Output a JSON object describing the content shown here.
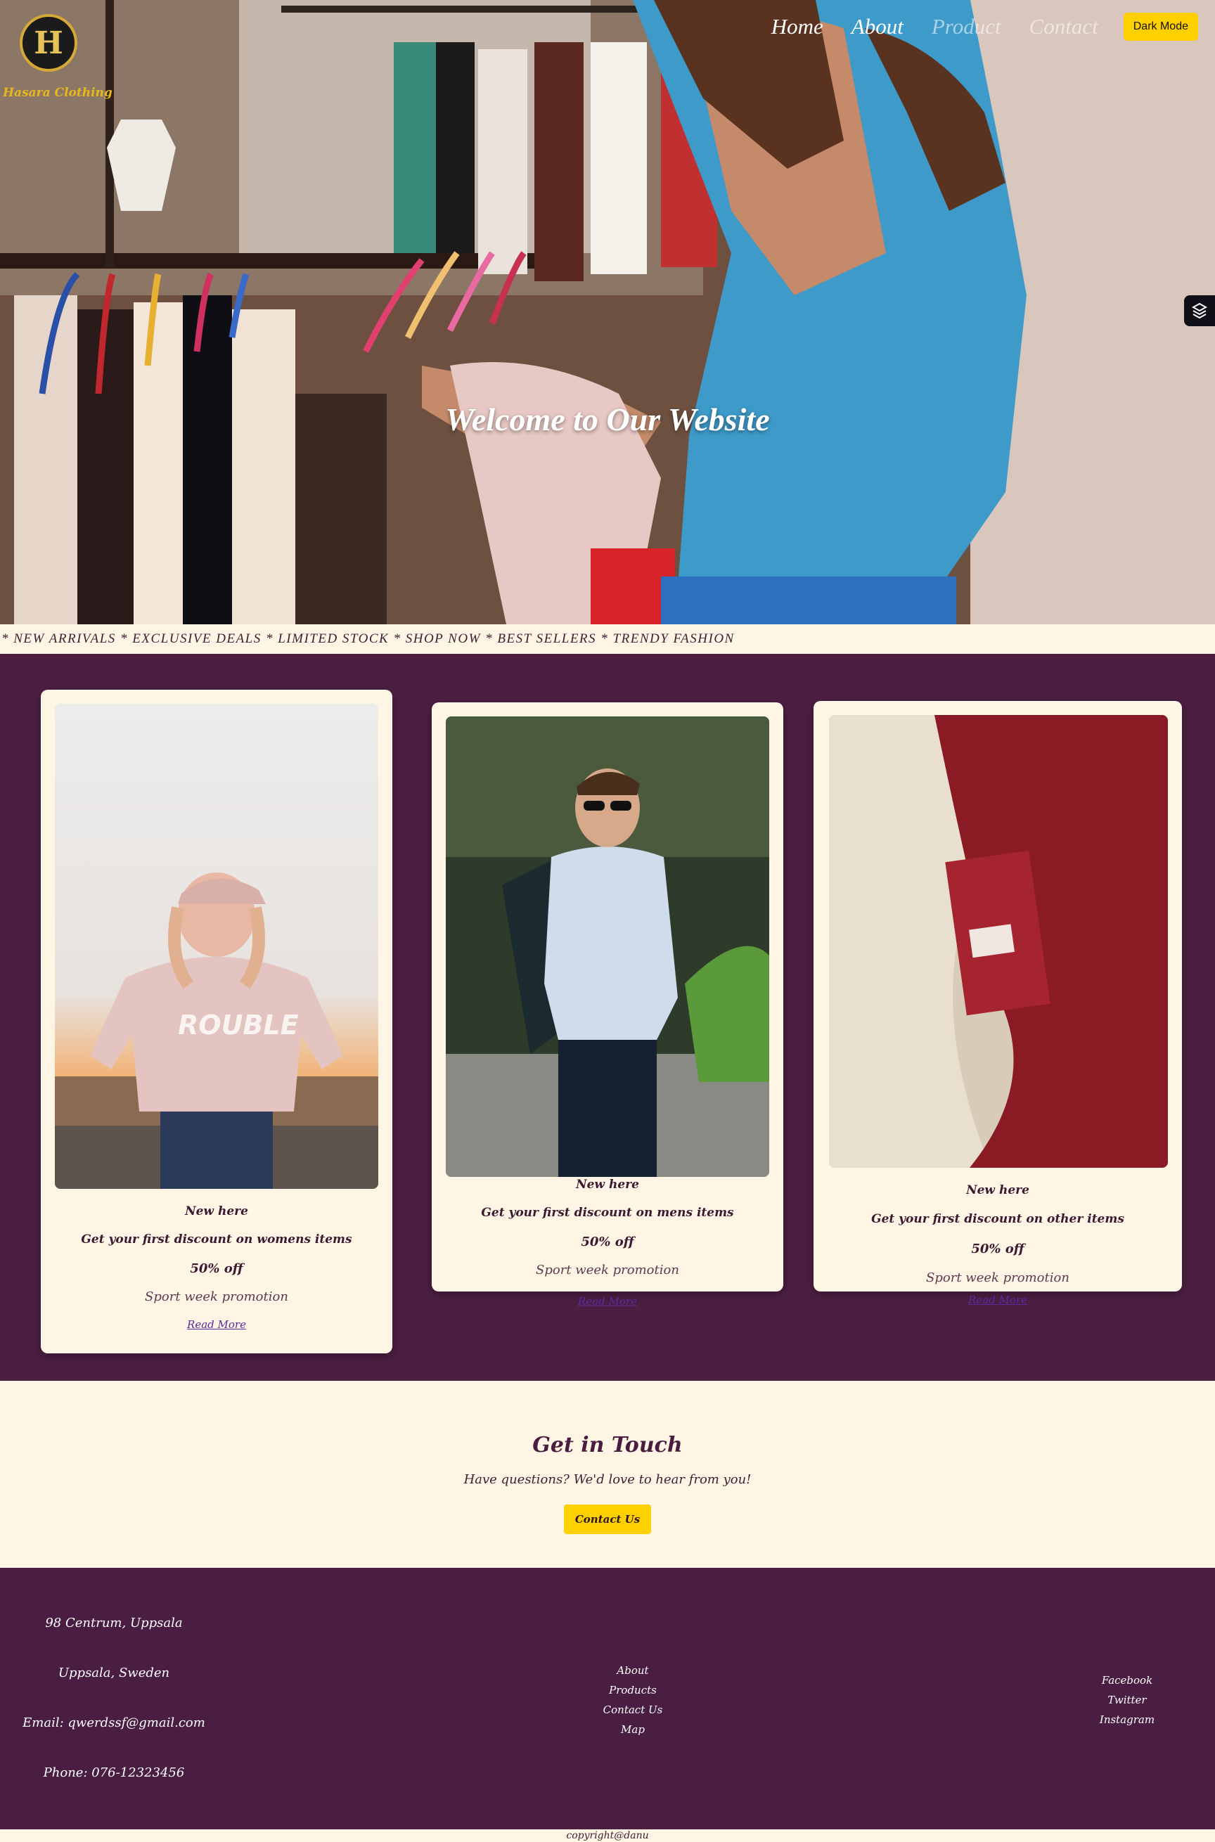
{
  "brand": {
    "name": "Hasara Clothing",
    "logo_letter": "H"
  },
  "nav": {
    "items": [
      "Home",
      "About",
      "Product",
      "Contact"
    ],
    "dark_mode_label": "Dark Mode"
  },
  "hero": {
    "title": "Welcome to Our Website",
    "subtitle": ""
  },
  "ticker": {
    "text": "* NEW ARRIVALS * EXCLUSIVE DEALS * LIMITED STOCK * SHOP NOW * BEST SELLERS * TRENDY FASHION"
  },
  "cards": [
    {
      "tag": "New here",
      "desc": "Get your first discount on womens items",
      "offer": "50% off",
      "promo": "Sport week promotion",
      "link": "Read More"
    },
    {
      "tag": "New here",
      "desc": "Get your first discount on mens items",
      "offer": "50% off",
      "promo": "Sport week promotion",
      "link": "Read More"
    },
    {
      "tag": "New here",
      "desc": "Get your first discount on other items",
      "offer": "50% off",
      "promo": "Sport week promotion",
      "link": "Read More"
    }
  ],
  "contact": {
    "title": "Get in Touch",
    "text": "Have questions? We'd love to hear from you!",
    "button": "Contact Us"
  },
  "footer": {
    "address": [
      "98 Centrum, Uppsala",
      "Uppsala, Sweden",
      "Email: qwerdssf@gmail.com",
      "Phone: 076-12323456"
    ],
    "links": [
      "About",
      "Products",
      "Contact Us",
      "Map"
    ],
    "social": [
      "Facebook",
      "Twitter",
      "Instagram"
    ],
    "copyright": "copyright@danu"
  },
  "colors": {
    "accent_yellow": "#ffd000",
    "brand_gold": "#e8b81a",
    "plum": "#4c1f42",
    "cream": "#fff5e4"
  },
  "icons": [
    "side-badge-icon"
  ]
}
